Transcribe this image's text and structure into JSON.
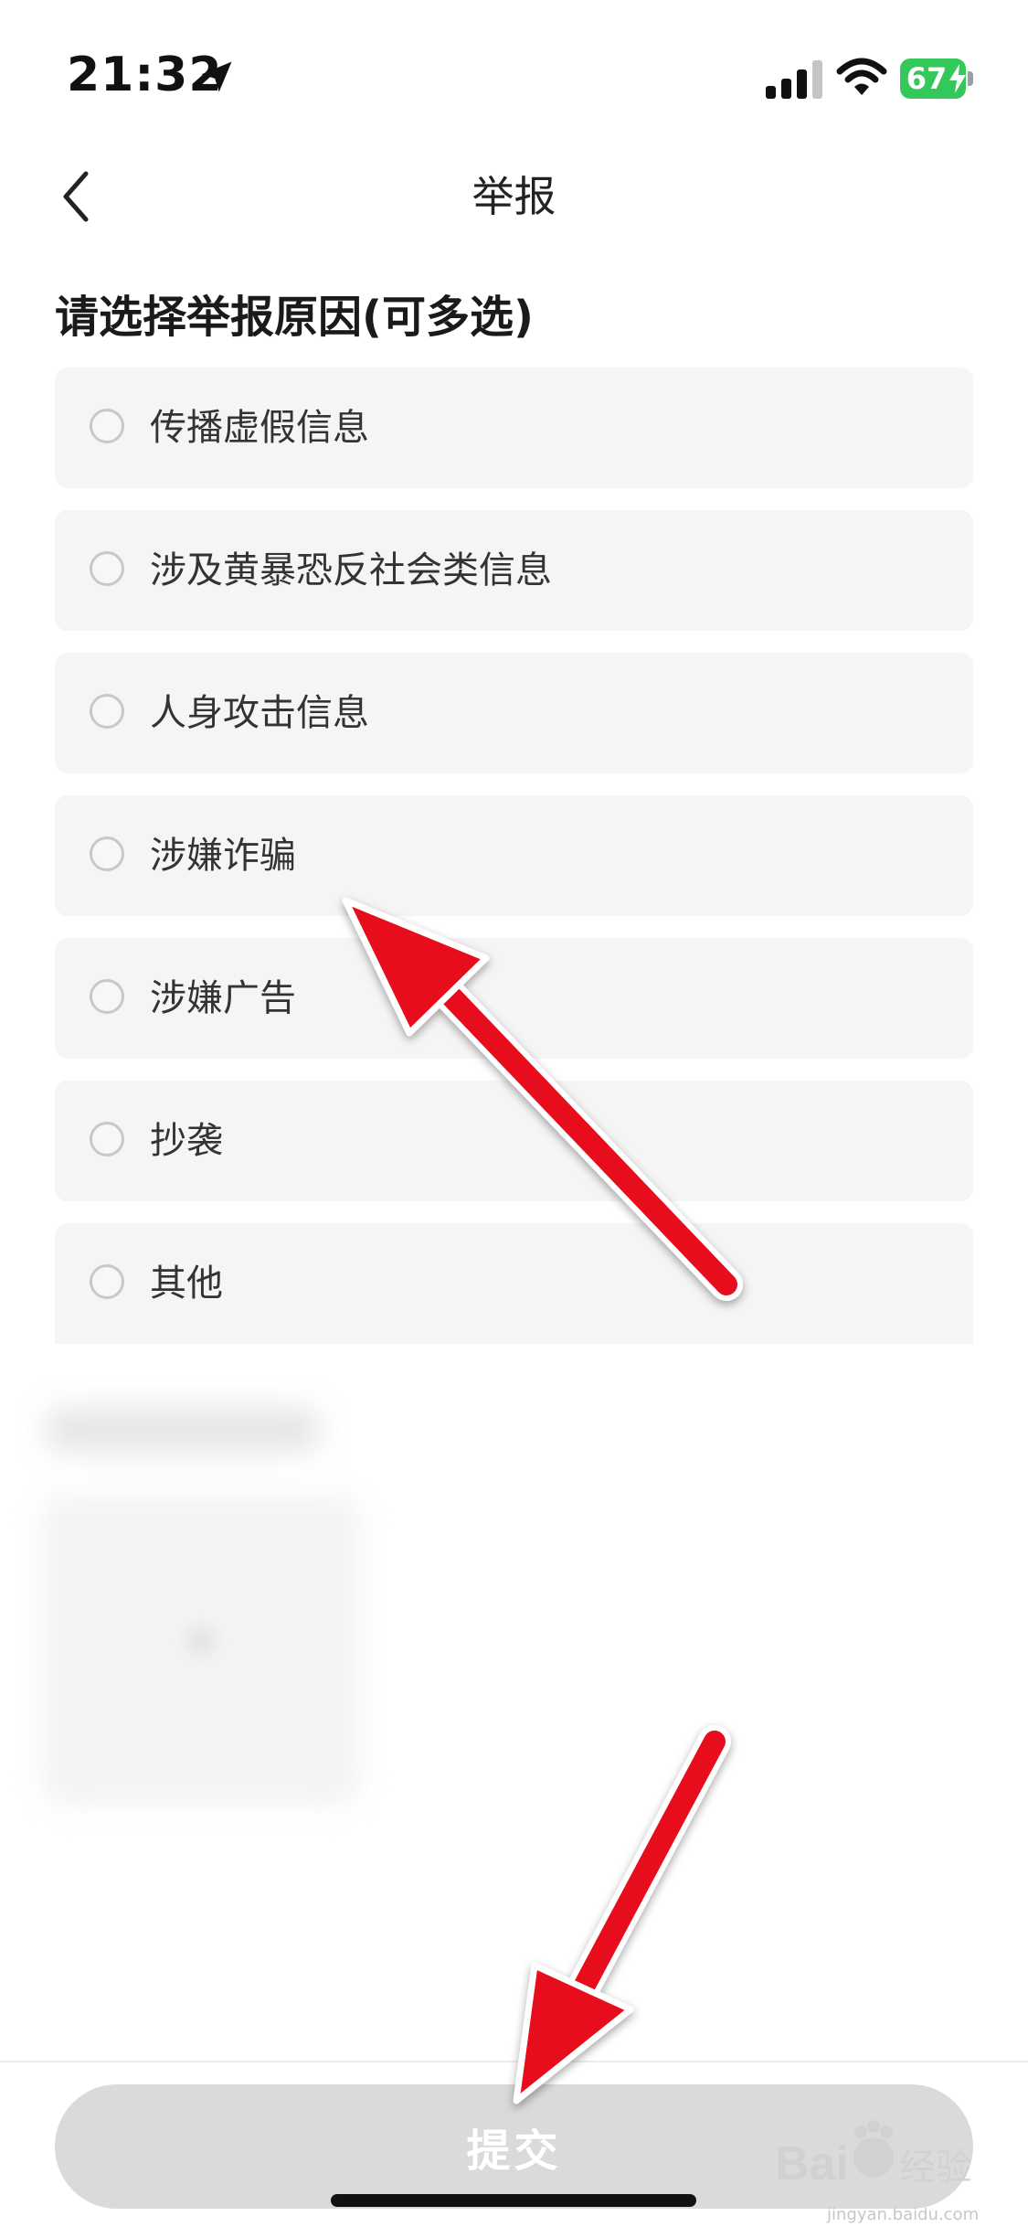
{
  "status_bar": {
    "time": "21:32",
    "battery_level": "67",
    "icons": [
      "location-arrow-icon",
      "cellular-signal-icon",
      "wifi-icon",
      "battery-charging-icon"
    ]
  },
  "nav": {
    "title": "举报",
    "back_icon": "chevron-left-icon"
  },
  "section": {
    "heading": "请选择举报原因(可多选)"
  },
  "options": [
    {
      "label": "传播虚假信息",
      "selected": false
    },
    {
      "label": "涉及黄暴恐反社会类信息",
      "selected": false
    },
    {
      "label": "人身攻击信息",
      "selected": false
    },
    {
      "label": "涉嫌诈骗",
      "selected": false
    },
    {
      "label": "涉嫌广告",
      "selected": false
    },
    {
      "label": "抄袭",
      "selected": false
    },
    {
      "label": "其他",
      "selected": false
    }
  ],
  "footer": {
    "submit_label": "提交"
  },
  "watermark": {
    "brand": "Baidu",
    "brand_cn": "经验",
    "url": "jingyan.baidu.com"
  },
  "colors": {
    "background": "#ffffff",
    "option_bg": "#f5f5f5",
    "submit_disabled": "#dadada",
    "battery": "#34c759",
    "annotation_arrow": "#e8111a"
  }
}
